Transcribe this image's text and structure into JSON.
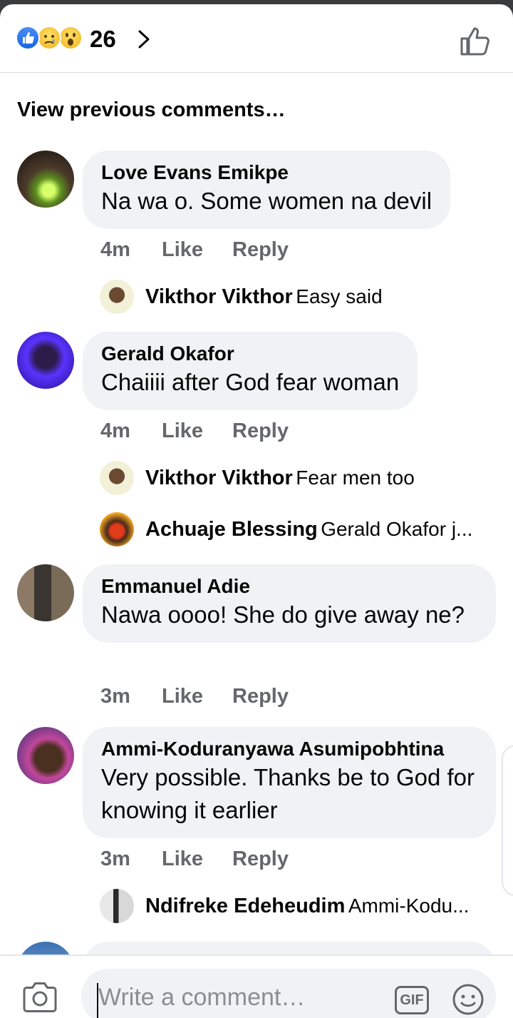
{
  "header": {
    "reaction_count": "26",
    "reaction_icons": [
      "like-icon",
      "sad-icon",
      "wow-icon"
    ]
  },
  "view_previous": "View previous comments…",
  "comments": [
    {
      "name": "Love Evans Emikpe",
      "text": "Na wa o. Some women na devil",
      "time": "4m",
      "like": "Like",
      "reply": "Reply",
      "replies": [
        {
          "name": "Vikthor Vikthor",
          "text": "Easy said"
        }
      ]
    },
    {
      "name": "Gerald Okafor",
      "text": "Chaiiii after God fear woman",
      "time": "4m",
      "like": "Like",
      "reply": "Reply",
      "replies": [
        {
          "name": "Vikthor Vikthor",
          "text": "Fear men too"
        },
        {
          "name": "Achuaje Blessing",
          "text": "Gerald Okafor j..."
        }
      ]
    },
    {
      "name": "Emmanuel Adie",
      "text": "Nawa oooo! She do give away ne?",
      "time": "3m",
      "like": "Like",
      "reply": "Reply",
      "replies": []
    },
    {
      "name": "Ammi-Koduranyawa Asumipobhtina",
      "text": "Very possible. Thanks be to God for knowing it earlier",
      "time": "3m",
      "like": "Like",
      "reply": "Reply",
      "replies": [
        {
          "name": "Ndifreke Edeheudim",
          "text": "Ammi-Kodu..."
        }
      ]
    }
  ],
  "composer": {
    "placeholder": "Write a comment…",
    "gif_label": "GIF"
  },
  "colors": {
    "bubble": "#f0f2f5",
    "meta_text": "#65676b",
    "like_blue": "#1877f2"
  }
}
